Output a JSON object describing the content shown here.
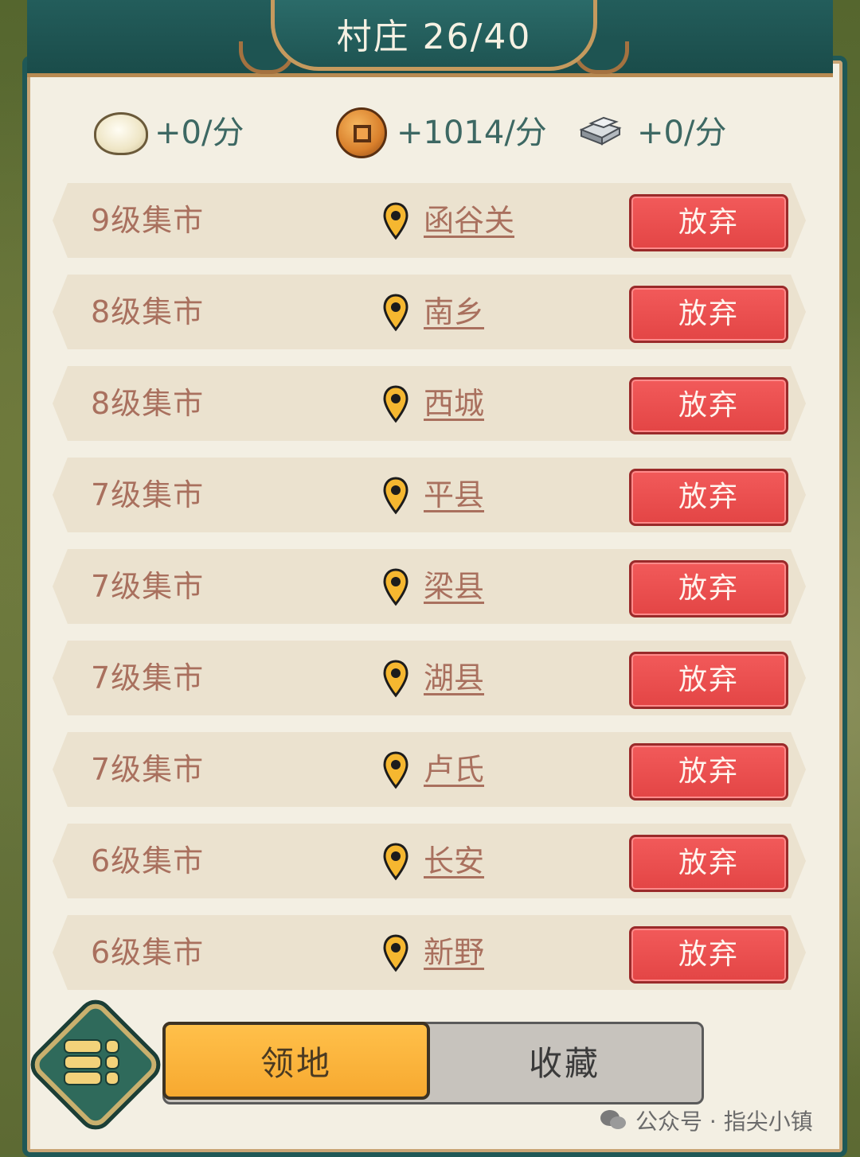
{
  "header": {
    "title": "村庄 26/40"
  },
  "resources": [
    {
      "icon": "bun-icon",
      "text": "+0/分"
    },
    {
      "icon": "coin-icon",
      "text": "+1014/分"
    },
    {
      "icon": "iron-ingot-icon",
      "text": "+0/分"
    }
  ],
  "villages": [
    {
      "level": "9级集市",
      "place": "函谷关",
      "action": "放弃"
    },
    {
      "level": "8级集市",
      "place": "南乡",
      "action": "放弃"
    },
    {
      "level": "8级集市",
      "place": "西城",
      "action": "放弃"
    },
    {
      "level": "7级集市",
      "place": "平县",
      "action": "放弃"
    },
    {
      "level": "7级集市",
      "place": "梁县",
      "action": "放弃"
    },
    {
      "level": "7级集市",
      "place": "湖县",
      "action": "放弃"
    },
    {
      "level": "7级集市",
      "place": "卢氏",
      "action": "放弃"
    },
    {
      "level": "6级集市",
      "place": "长安",
      "action": "放弃"
    },
    {
      "level": "6级集市",
      "place": "新野",
      "action": "放弃"
    }
  ],
  "tabs": {
    "active": "领地",
    "inactive": "收藏"
  },
  "watermark": {
    "text": "公众号 · 指尖小镇"
  },
  "colors": {
    "abandon_button": "#e34545",
    "active_tab": "#f7a930",
    "frame": "#1f5856",
    "text_brown": "#a9705e"
  }
}
